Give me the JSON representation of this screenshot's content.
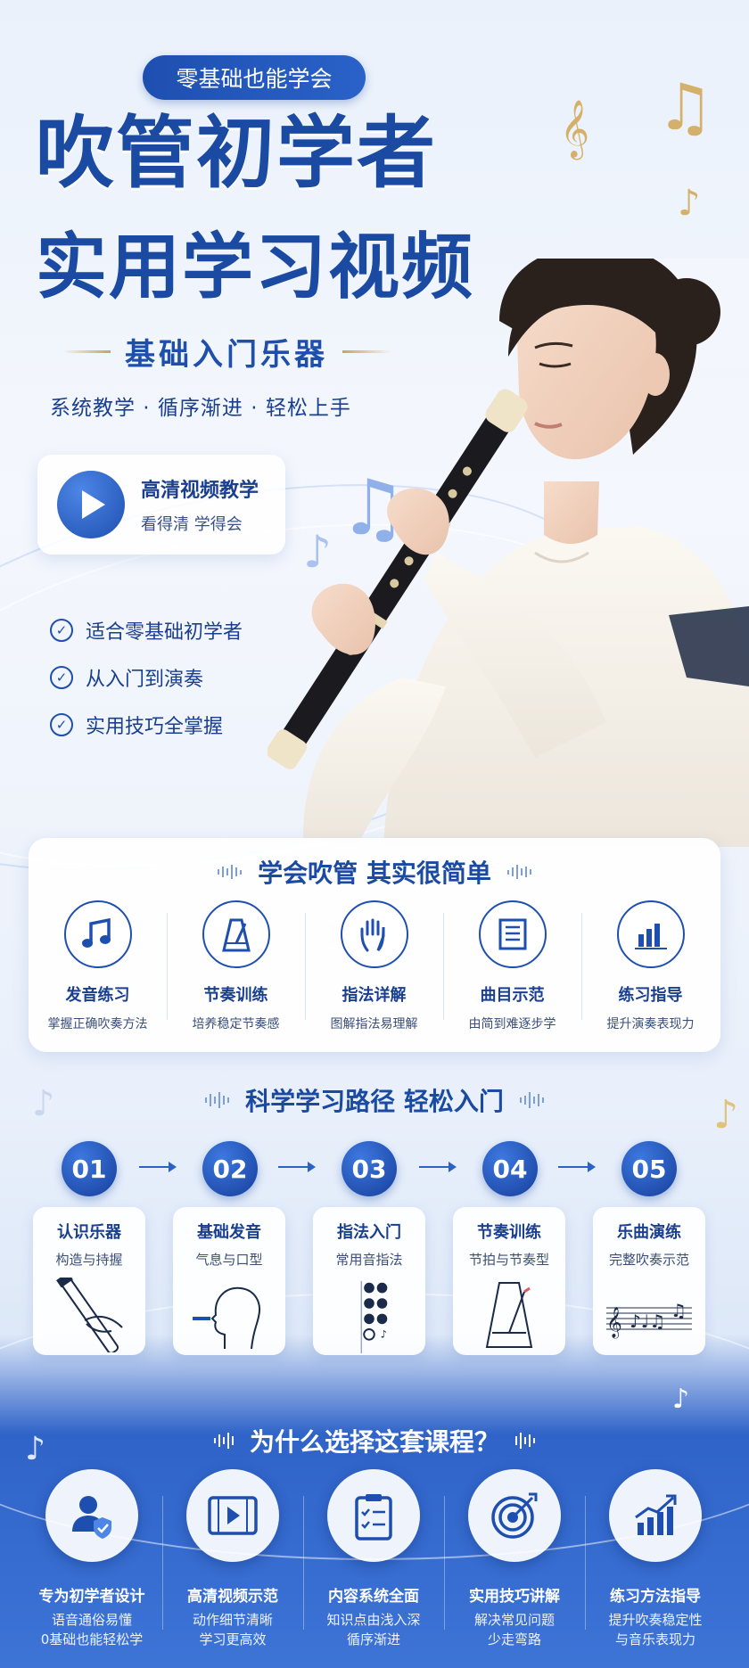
{
  "hero": {
    "badge": "零基础也能学会",
    "title_line1": "吹管初学者",
    "title_line2": "实用学习视频",
    "subtitle": "基础入门乐器",
    "tagline": "系统教学 · 循序渐进 · 轻松上手"
  },
  "video_card": {
    "title": "高清视频教学",
    "subtitle": "看得清 学得会"
  },
  "checklist": [
    {
      "label": "适合零基础初学者",
      "icon": "check-circle-icon"
    },
    {
      "label": "从入门到演奏",
      "icon": "check-circle-icon"
    },
    {
      "label": "实用技巧全掌握",
      "icon": "check-circle-icon"
    }
  ],
  "features": {
    "heading": "学会吹管  其实很简单",
    "items": [
      {
        "title": "发音练习",
        "desc": "掌握正确吹奏方法",
        "icon": "music-note-icon"
      },
      {
        "title": "节奏训练",
        "desc": "培养稳定节奏感",
        "icon": "metronome-icon"
      },
      {
        "title": "指法详解",
        "desc": "图解指法易理解",
        "icon": "hand-icon"
      },
      {
        "title": "曲目示范",
        "desc": "由简到难逐步学",
        "icon": "sheet-list-icon"
      },
      {
        "title": "练习指导",
        "desc": "提升演奏表现力",
        "icon": "bar-chart-icon"
      }
    ]
  },
  "path": {
    "heading": "科学学习路径  轻松入门",
    "steps": [
      {
        "num": "01",
        "title": "认识乐器",
        "sub": "构造与持握",
        "icon": "hand-holding-pipe-icon"
      },
      {
        "num": "02",
        "title": "基础发音",
        "sub": "气息与口型",
        "icon": "head-profile-icon"
      },
      {
        "num": "03",
        "title": "指法入门",
        "sub": "常用音指法",
        "icon": "fingering-chart-icon"
      },
      {
        "num": "04",
        "title": "节奏训练",
        "sub": "节拍与节奏型",
        "icon": "metronome-icon"
      },
      {
        "num": "05",
        "title": "乐曲演练",
        "sub": "完整吹奏示范",
        "icon": "music-staff-icon"
      }
    ]
  },
  "why": {
    "heading": "为什么选择这套课程？",
    "items": [
      {
        "title": "专为初学者设计",
        "desc1": "语音通俗易懂",
        "desc2": "0基础也能轻松学",
        "icon": "user-shield-icon"
      },
      {
        "title": "高清视频示范",
        "desc1": "动作细节清晰",
        "desc2": "学习更高效",
        "icon": "video-play-icon"
      },
      {
        "title": "内容系统全面",
        "desc1": "知识点由浅入深",
        "desc2": "循序渐进",
        "icon": "clipboard-checklist-icon"
      },
      {
        "title": "实用技巧讲解",
        "desc1": "解决常见问题",
        "desc2": "少走弯路",
        "icon": "target-icon"
      },
      {
        "title": "练习方法指导",
        "desc1": "提升吹奏稳定性",
        "desc2": "与音乐表现力",
        "icon": "growth-chart-icon"
      }
    ]
  },
  "colors": {
    "primary": "#1b4aa3",
    "accent_gold": "#c9a45a",
    "bottom_blue": "#3d74d6"
  }
}
